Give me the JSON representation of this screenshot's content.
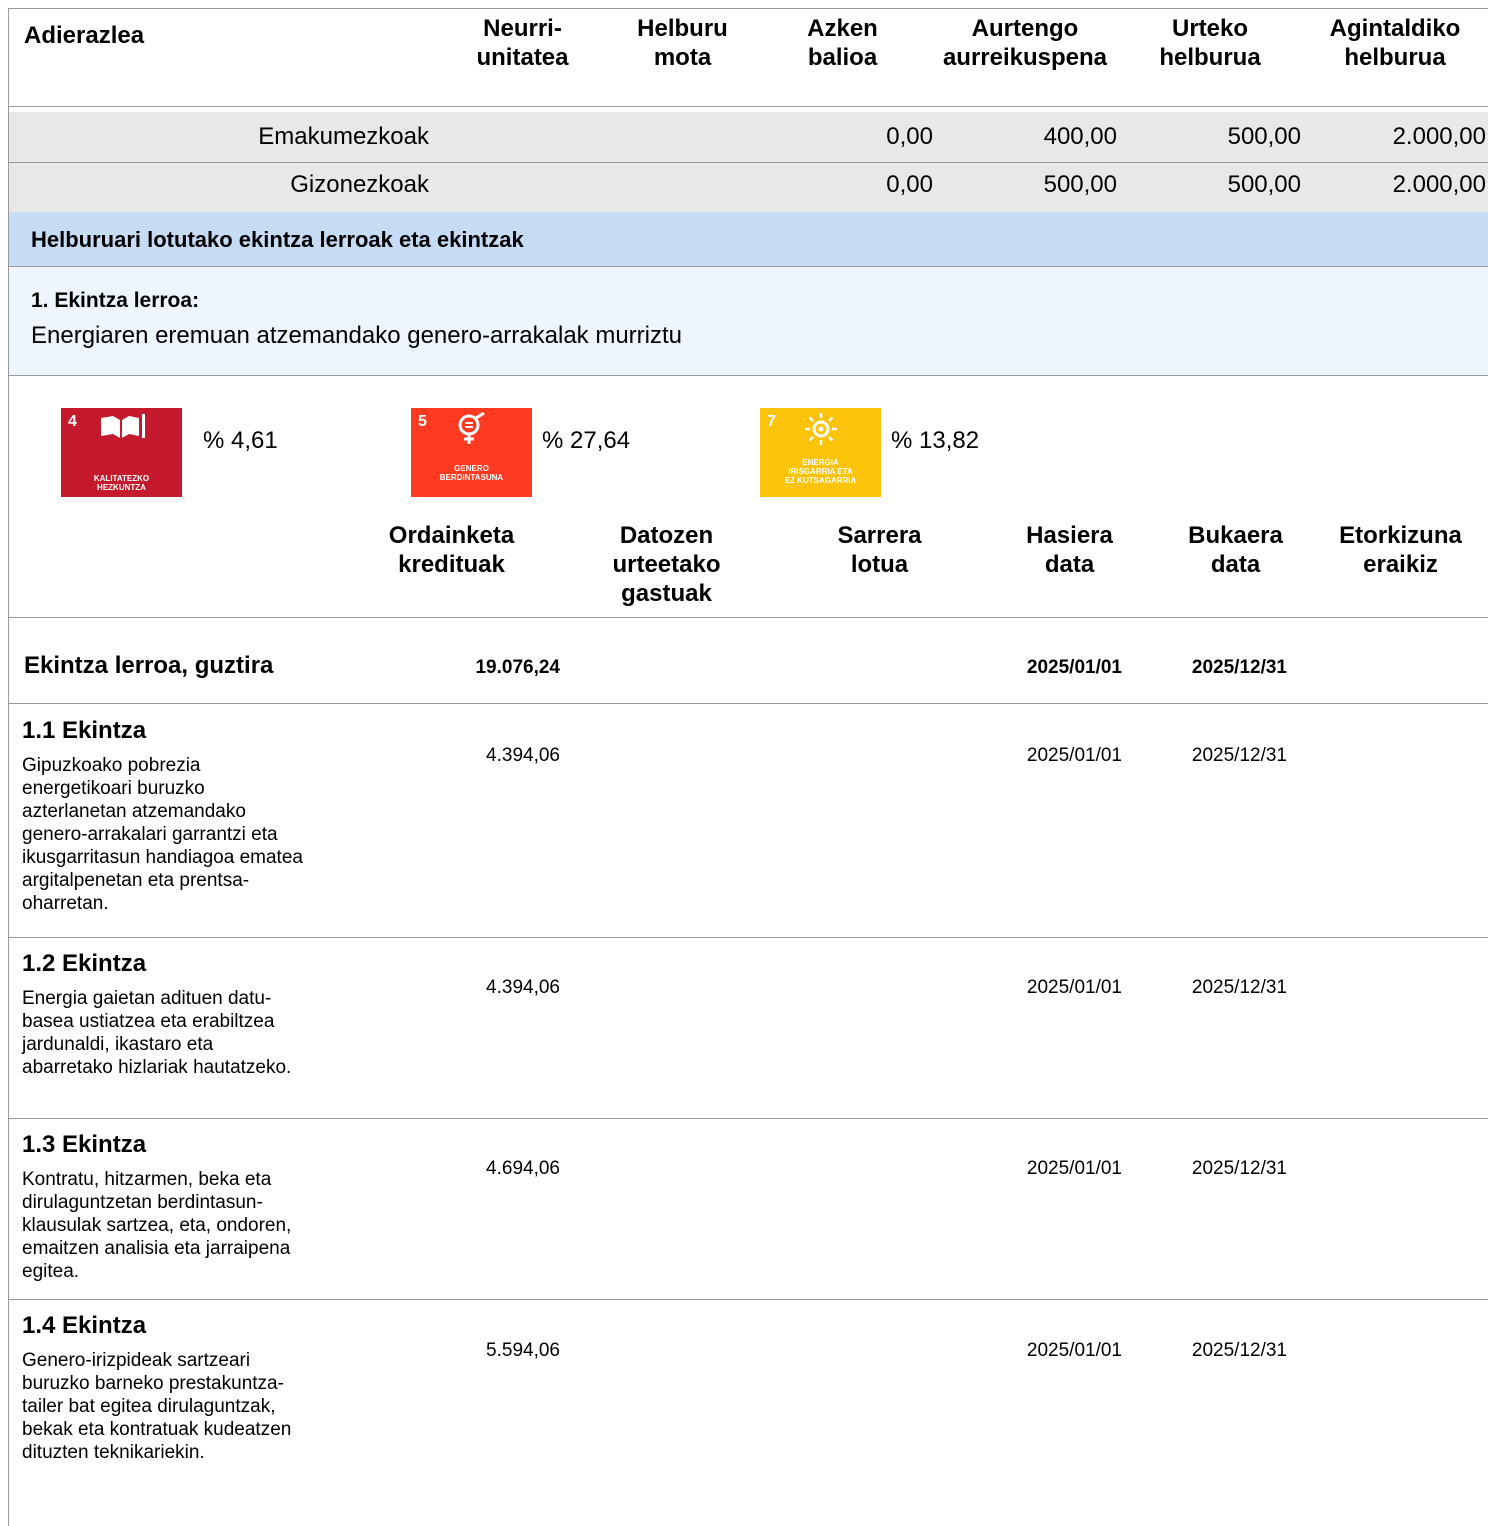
{
  "indicator_table": {
    "headers": {
      "adierazlea": "Adierazlea",
      "neurri": [
        "Neurri-",
        "unitatea"
      ],
      "helburu_mota": [
        "Helburu",
        "mota"
      ],
      "azken_balioa": [
        "Azken",
        "balioa"
      ],
      "aurtengo": [
        "Aurtengo",
        "aurreikuspena"
      ],
      "urteko": [
        "Urteko",
        "helburua"
      ],
      "agintaldiko": [
        "Agintaldiko",
        "helburua"
      ]
    },
    "rows": [
      {
        "label": "Emakumezkoak",
        "azken": "0,00",
        "aurtengo": "400,00",
        "urteko": "500,00",
        "agintaldiko": "2.000,00"
      },
      {
        "label": "Gizonezkoak",
        "azken": "0,00",
        "aurtengo": "500,00",
        "urteko": "500,00",
        "agintaldiko": "2.000,00"
      }
    ]
  },
  "section_title": "Helburuari lotutako ekintza lerroak eta ekintzak",
  "action_line": {
    "heading": "1. Ekintza lerroa:",
    "description": "Energiaren eremuan atzemandako genero-arrakalak murriztu"
  },
  "sdgs": [
    {
      "number": "4",
      "caption": [
        "KALITATEZKO",
        "HEZKUNTZA"
      ],
      "percent": "% 4,61",
      "color": "#c5192d",
      "icon": "book-icon"
    },
    {
      "number": "5",
      "caption": [
        "GENERO",
        "BERDINTASUNA"
      ],
      "percent": "% 27,64",
      "color": "#ff3a21",
      "icon": "gender-equality-icon"
    },
    {
      "number": "7",
      "caption": [
        "ENERGIA",
        "IRISGARRIA ETA",
        "EZ KUTSAGARRIA"
      ],
      "percent": "% 13,82",
      "color": "#fcc30b",
      "icon": "sun-icon"
    }
  ],
  "budget_headers": {
    "ordainketa": [
      "Ordainketa",
      "kredituak"
    ],
    "datozen": [
      "Datozen",
      "urteetako",
      "gastuak"
    ],
    "sarrera": [
      "Sarrera",
      "lotua"
    ],
    "hasiera": [
      "Hasiera",
      "data"
    ],
    "bukaera": [
      "Bukaera",
      "data"
    ],
    "etorkizuna": [
      "Etorkizuna",
      "eraikiz"
    ]
  },
  "total_row": {
    "label": "Ekintza lerroa, guztira",
    "ordainketa": "19.076,24",
    "hasiera": "2025/01/01",
    "bukaera": "2025/12/31"
  },
  "actions": [
    {
      "title": "1.1 Ekintza",
      "description": [
        "Gipuzkoako pobrezia",
        "energetikoari buruzko",
        "azterlanetan atzemandako",
        "genero-arrakalari garrantzi eta",
        "ikusgarritasun handiagoa ematea",
        "argitalpenetan eta prentsa-",
        "oharretan."
      ],
      "ordainketa": "4.394,06",
      "hasiera": "2025/01/01",
      "bukaera": "2025/12/31"
    },
    {
      "title": "1.2 Ekintza",
      "description": [
        "Energia gaietan adituen datu-",
        "basea ustiatzea eta erabiltzea",
        "jardunaldi, ikastaro eta",
        "abarretako hizlariak hautatzeko."
      ],
      "ordainketa": "4.394,06",
      "hasiera": "2025/01/01",
      "bukaera": "2025/12/31"
    },
    {
      "title": "1.3 Ekintza",
      "description": [
        "Kontratu, hitzarmen, beka eta",
        "dirulaguntzetan berdintasun-",
        "klausulak sartzea, eta, ondoren,",
        "emaitzen analisia eta jarraipena",
        "egitea."
      ],
      "ordainketa": "4.694,06",
      "hasiera": "2025/01/01",
      "bukaera": "2025/12/31"
    },
    {
      "title": "1.4 Ekintza",
      "description": [
        "Genero-irizpideak sartzeari",
        "buruzko barneko prestakuntza-",
        "tailer bat egitea dirulaguntzak,",
        "bekak eta kontratuak kudeatzen",
        "dituzten teknikariekin."
      ],
      "ordainketa": "5.594,06",
      "hasiera": "2025/01/01",
      "bukaera": "2025/12/31"
    }
  ]
}
